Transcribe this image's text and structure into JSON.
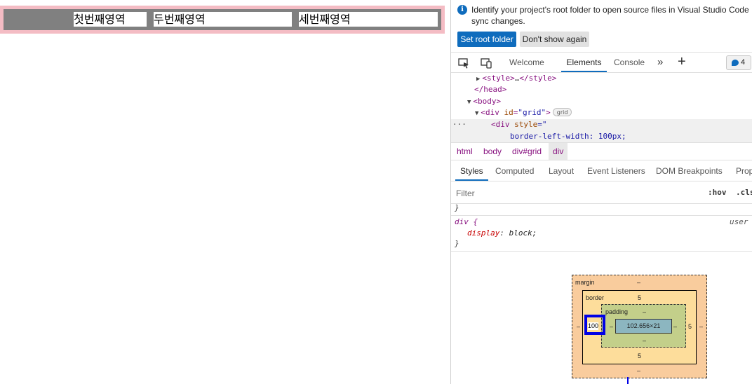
{
  "preview": {
    "cells": [
      "첫번째영역",
      "두번째영역",
      "세번째영역"
    ]
  },
  "infobar": {
    "message": "Identify your project's root folder to open source files in Visual Studio Code sync changes.",
    "primary_button": "Set root folder",
    "secondary_button": "Don't show again"
  },
  "toolbar": {
    "tabs": [
      "Welcome",
      "Elements",
      "Console"
    ],
    "active_tab": "Elements",
    "issues_count": "4"
  },
  "dom": {
    "line1_tag": "<style>",
    "line1_ellipsis": "…",
    "line1_close": "</style>",
    "line2": "</head>",
    "line3": "<body>",
    "line4_open": "<div ",
    "line4_attr": "id",
    "line4_val": "\"grid\"",
    "line4_close": ">",
    "line4_pill": "grid",
    "line5_open": "<div ",
    "line5_attr": "style",
    "line5_eq": "=\"",
    "line6": "border-left-width: 100px;",
    "ellipsis": "···"
  },
  "breadcrumbs": [
    "html",
    "body",
    "div#grid",
    "div"
  ],
  "subtabs": [
    "Styles",
    "Computed",
    "Layout",
    "Event Listeners",
    "DOM Breakpoints",
    "Prop"
  ],
  "filter": {
    "placeholder": "Filter",
    "hov": ":hov",
    "cls": ".cls"
  },
  "rules": {
    "prev_close": "}",
    "selector": "div {",
    "origin": "user",
    "property": "display",
    "value": "block;",
    "close": "}"
  },
  "box_model": {
    "margin_label": "margin",
    "margin_top": "–",
    "margin_bottom": "–",
    "margin_left": "–",
    "margin_right": "–",
    "border_label": "border",
    "border_top": "5",
    "border_bottom": "5",
    "border_left": "100",
    "border_right": "5",
    "padding_label": "padding",
    "padding_top": "–",
    "padding_bottom": "–",
    "padding_left": "–",
    "padding_right": "–",
    "content": "102.656×21"
  }
}
